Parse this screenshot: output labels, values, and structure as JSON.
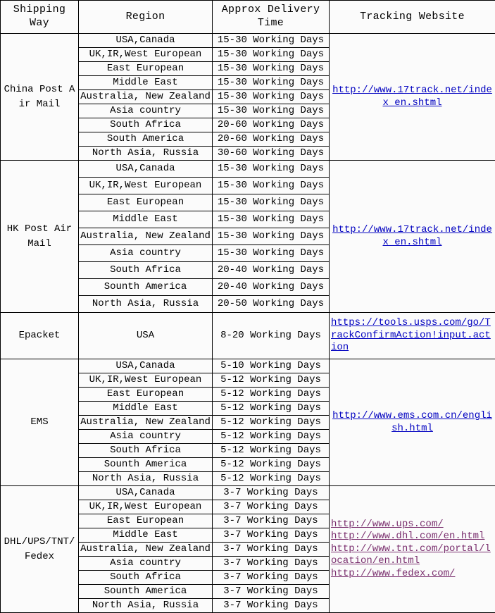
{
  "table": {
    "headers": [
      {
        "label": "Shipping Way",
        "name": "shipping-way"
      },
      {
        "label": "Region",
        "name": "region"
      },
      {
        "label": "Approx Delivery Time",
        "name": "approx-delivery-time"
      },
      {
        "label": "Tracking Website",
        "name": "tracking-website"
      }
    ],
    "colors": {
      "header_background": "#c0c0c0",
      "cell_background": "#fbfbfb",
      "border": "#000000",
      "link_blue": "#0000c0",
      "link_purple": "#7a2f6e",
      "text": "#000000"
    },
    "sections": [
      {
        "shipping_way": "China Post Air Mail",
        "tracking_links": [
          {
            "text": "http://www.17track.net/index_en.shtml",
            "color": "blue"
          }
        ],
        "link_align": "center",
        "rows": [
          {
            "region": "USA,Canada",
            "time": "15-30 Working Days"
          },
          {
            "region": "UK,IR,West European",
            "time": "15-30 Working Days"
          },
          {
            "region": "East European",
            "time": "15-30 Working Days"
          },
          {
            "region": "Middle East",
            "time": "15-30 Working Days"
          },
          {
            "region": "Australia, New Zealand",
            "time": "15-30 Working Days"
          },
          {
            "region": "Asia country",
            "time": "15-30 Working Days"
          },
          {
            "region": "South Africa",
            "time": "20-60 Working Days"
          },
          {
            "region": "South America",
            "time": "20-60 Working Days"
          },
          {
            "region": "North Asia, Russia",
            "time": "30-60 Working Days"
          }
        ]
      },
      {
        "shipping_way": "HK Post Air Mail",
        "tracking_links": [
          {
            "text": "http://www.17track.net/index_en.shtml",
            "color": "blue"
          }
        ],
        "link_align": "center",
        "rows": [
          {
            "region": "USA,Canada",
            "time": "15-30 Working Days"
          },
          {
            "region": "UK,IR,West European",
            "time": "15-30 Working Days"
          },
          {
            "region": "East European",
            "time": "15-30 Working Days"
          },
          {
            "region": "Middle East",
            "time": "15-30 Working Days"
          },
          {
            "region": "Australia, New Zealand",
            "time": "15-30 Working Days"
          },
          {
            "region": "Asia country",
            "time": "15-30 Working Days"
          },
          {
            "region": "South Africa",
            "time": "20-40 Working Days"
          },
          {
            "region": "Sounth America",
            "time": "20-40 Working Days"
          },
          {
            "region": "North Asia, Russia",
            "time": "20-50 Working Days"
          }
        ]
      },
      {
        "shipping_way": "Epacket",
        "tracking_links": [
          {
            "text": "https://tools.usps.com/go/TrackConfirmAction!input.action",
            "color": "blue"
          }
        ],
        "link_align": "left",
        "rows": [
          {
            "region": "USA",
            "time": "8-20 Working Days"
          }
        ]
      },
      {
        "shipping_way": "EMS",
        "tracking_links": [
          {
            "text": "http://www.ems.com.cn/english.html",
            "color": "blue"
          }
        ],
        "link_align": "center",
        "rows": [
          {
            "region": "USA,Canada",
            "time": "5-10 Working Days"
          },
          {
            "region": "UK,IR,West European",
            "time": "5-12 Working Days"
          },
          {
            "region": "East European",
            "time": "5-12 Working Days"
          },
          {
            "region": "Middle East",
            "time": "5-12 Working Days"
          },
          {
            "region": "Australia, New Zealand",
            "time": "5-12 Working Days"
          },
          {
            "region": "Asia country",
            "time": "5-12 Working Days"
          },
          {
            "region": "South Africa",
            "time": "5-12 Working Days"
          },
          {
            "region": "Sounth America",
            "time": "5-12 Working Days"
          },
          {
            "region": "North Asia, Russia",
            "time": "5-12 Working Days"
          }
        ]
      },
      {
        "shipping_way": "DHL/UPS/TNT/Fedex",
        "tracking_links": [
          {
            "text": "http://www.ups.com/",
            "color": "purple"
          },
          {
            "text": "http://www.dhl.com/en.html",
            "color": "purple"
          },
          {
            "text": "http://www.tnt.com/portal/location/en.html",
            "color": "purple"
          },
          {
            "text": "http://www.fedex.com/",
            "color": "purple"
          }
        ],
        "link_align": "left",
        "rows": [
          {
            "region": "USA,Canada",
            "time": "3-7 Working Days"
          },
          {
            "region": "UK,IR,West European",
            "time": "3-7 Working Days"
          },
          {
            "region": "East European",
            "time": "3-7 Working Days"
          },
          {
            "region": "Middle East",
            "time": "3-7 Working Days"
          },
          {
            "region": "Australia, New Zealand",
            "time": "3-7 Working Days"
          },
          {
            "region": "Asia country",
            "time": "3-7 Working Days"
          },
          {
            "region": "South Africa",
            "time": "3-7 Working Days"
          },
          {
            "region": "Sounth America",
            "time": "3-7 Working Days"
          },
          {
            "region": "North Asia, Russia",
            "time": "3-7 Working Days"
          }
        ]
      }
    ]
  }
}
